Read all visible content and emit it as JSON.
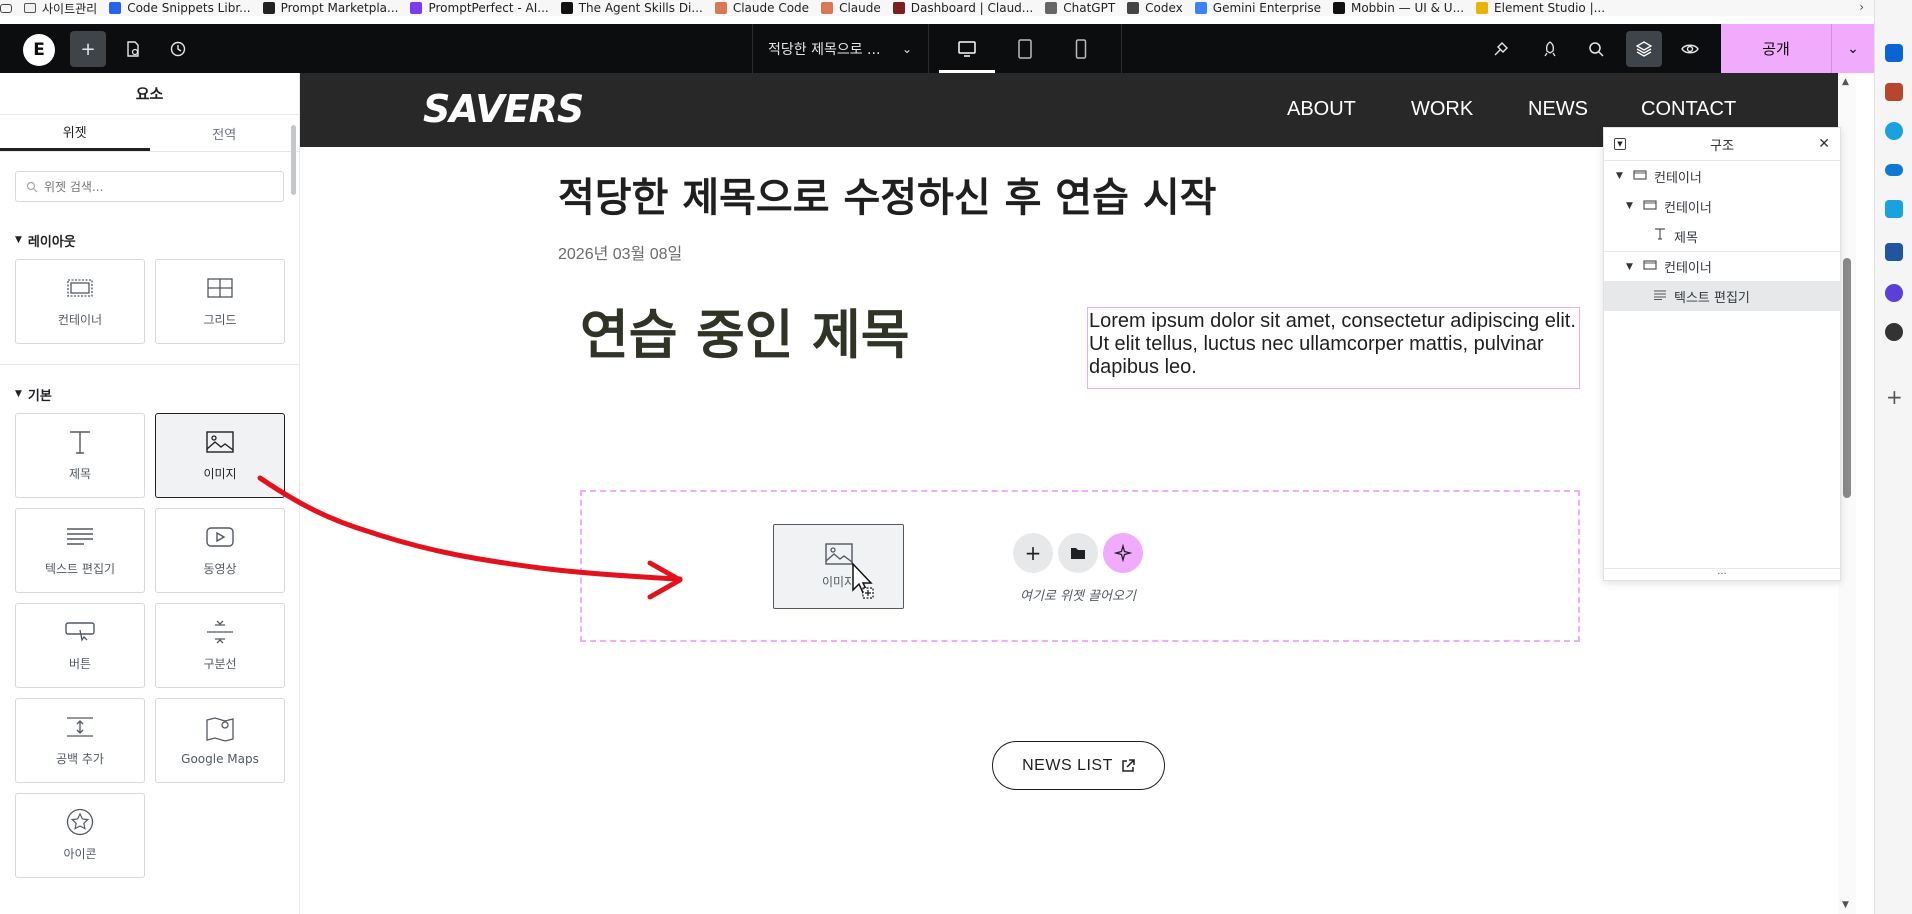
{
  "bookmarks": [
    {
      "label": "사이트관리",
      "color": "#f2f2f2",
      "icon": "folder-icon"
    },
    {
      "label": "Code Snippets Libr...",
      "color": "#2563eb",
      "icon": "code-icon"
    },
    {
      "label": "Prompt Marketpla...",
      "color": "#222222",
      "icon": "prompt-icon"
    },
    {
      "label": "PromptPerfect - AI...",
      "color": "#7c3aed",
      "icon": "perfect-icon"
    },
    {
      "label": "The Agent Skills Di...",
      "color": "#111111",
      "icon": "triangle-icon"
    },
    {
      "label": "Claude Code",
      "color": "#d97757",
      "icon": "claude-icon"
    },
    {
      "label": "Claude",
      "color": "#d97757",
      "icon": "claude-icon"
    },
    {
      "label": "Dashboard | Claud...",
      "color": "#7a1f1f",
      "icon": "dashboard-icon"
    },
    {
      "label": "ChatGPT",
      "color": "#666666",
      "icon": "chatgpt-icon"
    },
    {
      "label": "Codex",
      "color": "#444444",
      "icon": "codex-icon"
    },
    {
      "label": "Gemini Enterprise",
      "color": "#3b82f6",
      "icon": "gemini-icon"
    },
    {
      "label": "Mobbin — UI & U...",
      "color": "#111111",
      "icon": "mobbin-icon"
    },
    {
      "label": "Element Studio |...",
      "color": "#eab308",
      "icon": "element-icon"
    }
  ],
  "topbar": {
    "doc_title": "적당한 제목으로 ...",
    "publish_label": "공개"
  },
  "panel": {
    "title": "요소",
    "tabs": [
      "위젯",
      "전역"
    ],
    "search_placeholder": "위젯 검색...",
    "categories": {
      "layout": {
        "label": "레이아웃",
        "widgets": [
          {
            "label": "컨테이너",
            "icon": "container-icon"
          },
          {
            "label": "그리드",
            "icon": "grid-icon"
          }
        ]
      },
      "basic": {
        "label": "기본",
        "widgets": [
          {
            "label": "제목",
            "icon": "heading-icon"
          },
          {
            "label": "이미지",
            "icon": "image-icon",
            "selected": true
          },
          {
            "label": "텍스트 편집기",
            "icon": "text-editor-icon"
          },
          {
            "label": "동영상",
            "icon": "video-icon"
          },
          {
            "label": "버튼",
            "icon": "button-icon"
          },
          {
            "label": "구분선",
            "icon": "divider-icon"
          },
          {
            "label": "공백 추가",
            "icon": "spacer-icon"
          },
          {
            "label": "Google Maps",
            "icon": "map-icon"
          },
          {
            "label": "아이콘",
            "icon": "star-icon"
          }
        ]
      }
    }
  },
  "site": {
    "logo": "SAVERS",
    "nav": [
      "ABOUT",
      "WORK",
      "NEWS",
      "CONTACT"
    ],
    "post_title": "적당한 제목으로 수정하신 후 연습 시작",
    "post_date": "2026년 03월 08일",
    "practice_title": "연습 중인 제목",
    "lorem": "Lorem ipsum dolor sit amet, consectetur adipiscing elit. Ut elit tellus, luctus nec ullamcorper mattis, pulvinar dapibus leo.",
    "drag_label": "이미지",
    "drop_hint": "여기로 위젯 끌어오기",
    "news_list": "NEWS LIST"
  },
  "structure": {
    "title": "구조",
    "items": [
      {
        "label": "컨테이너",
        "level": 0,
        "icon": "container-icon",
        "expanded": true
      },
      {
        "label": "컨테이너",
        "level": 1,
        "icon": "container-icon",
        "expanded": true
      },
      {
        "label": "제목",
        "level": 2,
        "icon": "heading-icon"
      },
      {
        "label": "컨테이너",
        "level": 1,
        "icon": "container-icon",
        "expanded": true
      },
      {
        "label": "텍스트 편집기",
        "level": 2,
        "icon": "text-editor-icon",
        "selected": true
      }
    ]
  },
  "colors": {
    "accent_pink": "#f0abfc",
    "topbar_bg": "#0c0d0e",
    "site_header_bg": "#282828",
    "annotation_red": "#e3111b"
  }
}
